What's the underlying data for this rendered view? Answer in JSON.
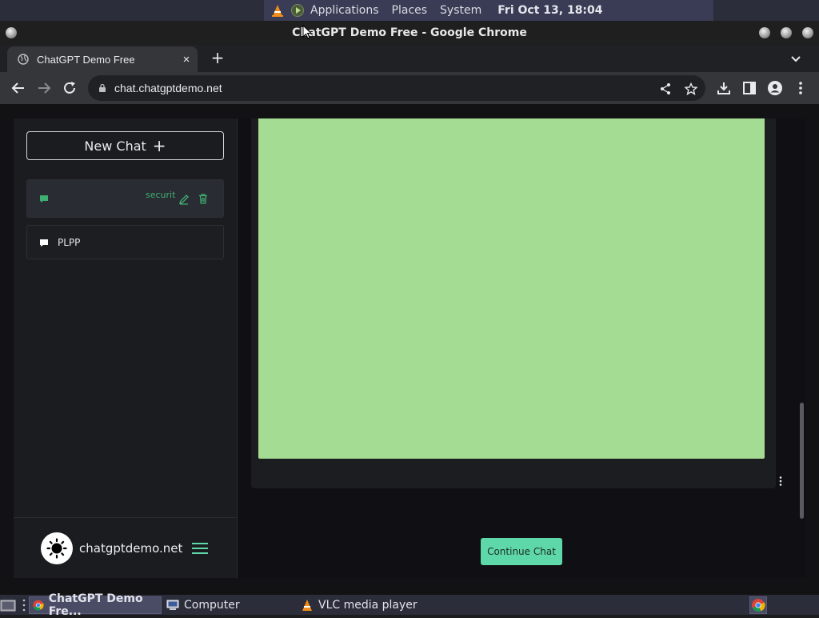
{
  "system_bar": {
    "menus": [
      "Applications",
      "Places",
      "System"
    ],
    "clock": "Fri Oct 13, 18:04"
  },
  "window": {
    "title": "ChatGPT Demo Free - Google Chrome"
  },
  "browser": {
    "tab_title": "ChatGPT Demo Free",
    "tab_close": "×",
    "new_tab": "+",
    "url": "chat.chatgptdemo.net"
  },
  "sidebar": {
    "new_chat_label": "New Chat",
    "new_chat_plus": "+",
    "chats": [
      {
        "label": "securit",
        "active": true
      },
      {
        "label": "PLPP",
        "active": false
      }
    ],
    "brand": "chatgptdemo.net"
  },
  "main": {
    "continue_label": "Continue Chat",
    "content_color": "#a3dc92",
    "button_color": "#5fd8a9"
  },
  "taskbar": {
    "items": [
      {
        "label": "ChatGPT Demo Fre...",
        "icon": "chrome-icon",
        "active": true
      },
      {
        "label": "Computer",
        "icon": "computer-icon",
        "active": false
      },
      {
        "label": "VLC media player",
        "icon": "vlc-icon",
        "active": false
      }
    ]
  }
}
